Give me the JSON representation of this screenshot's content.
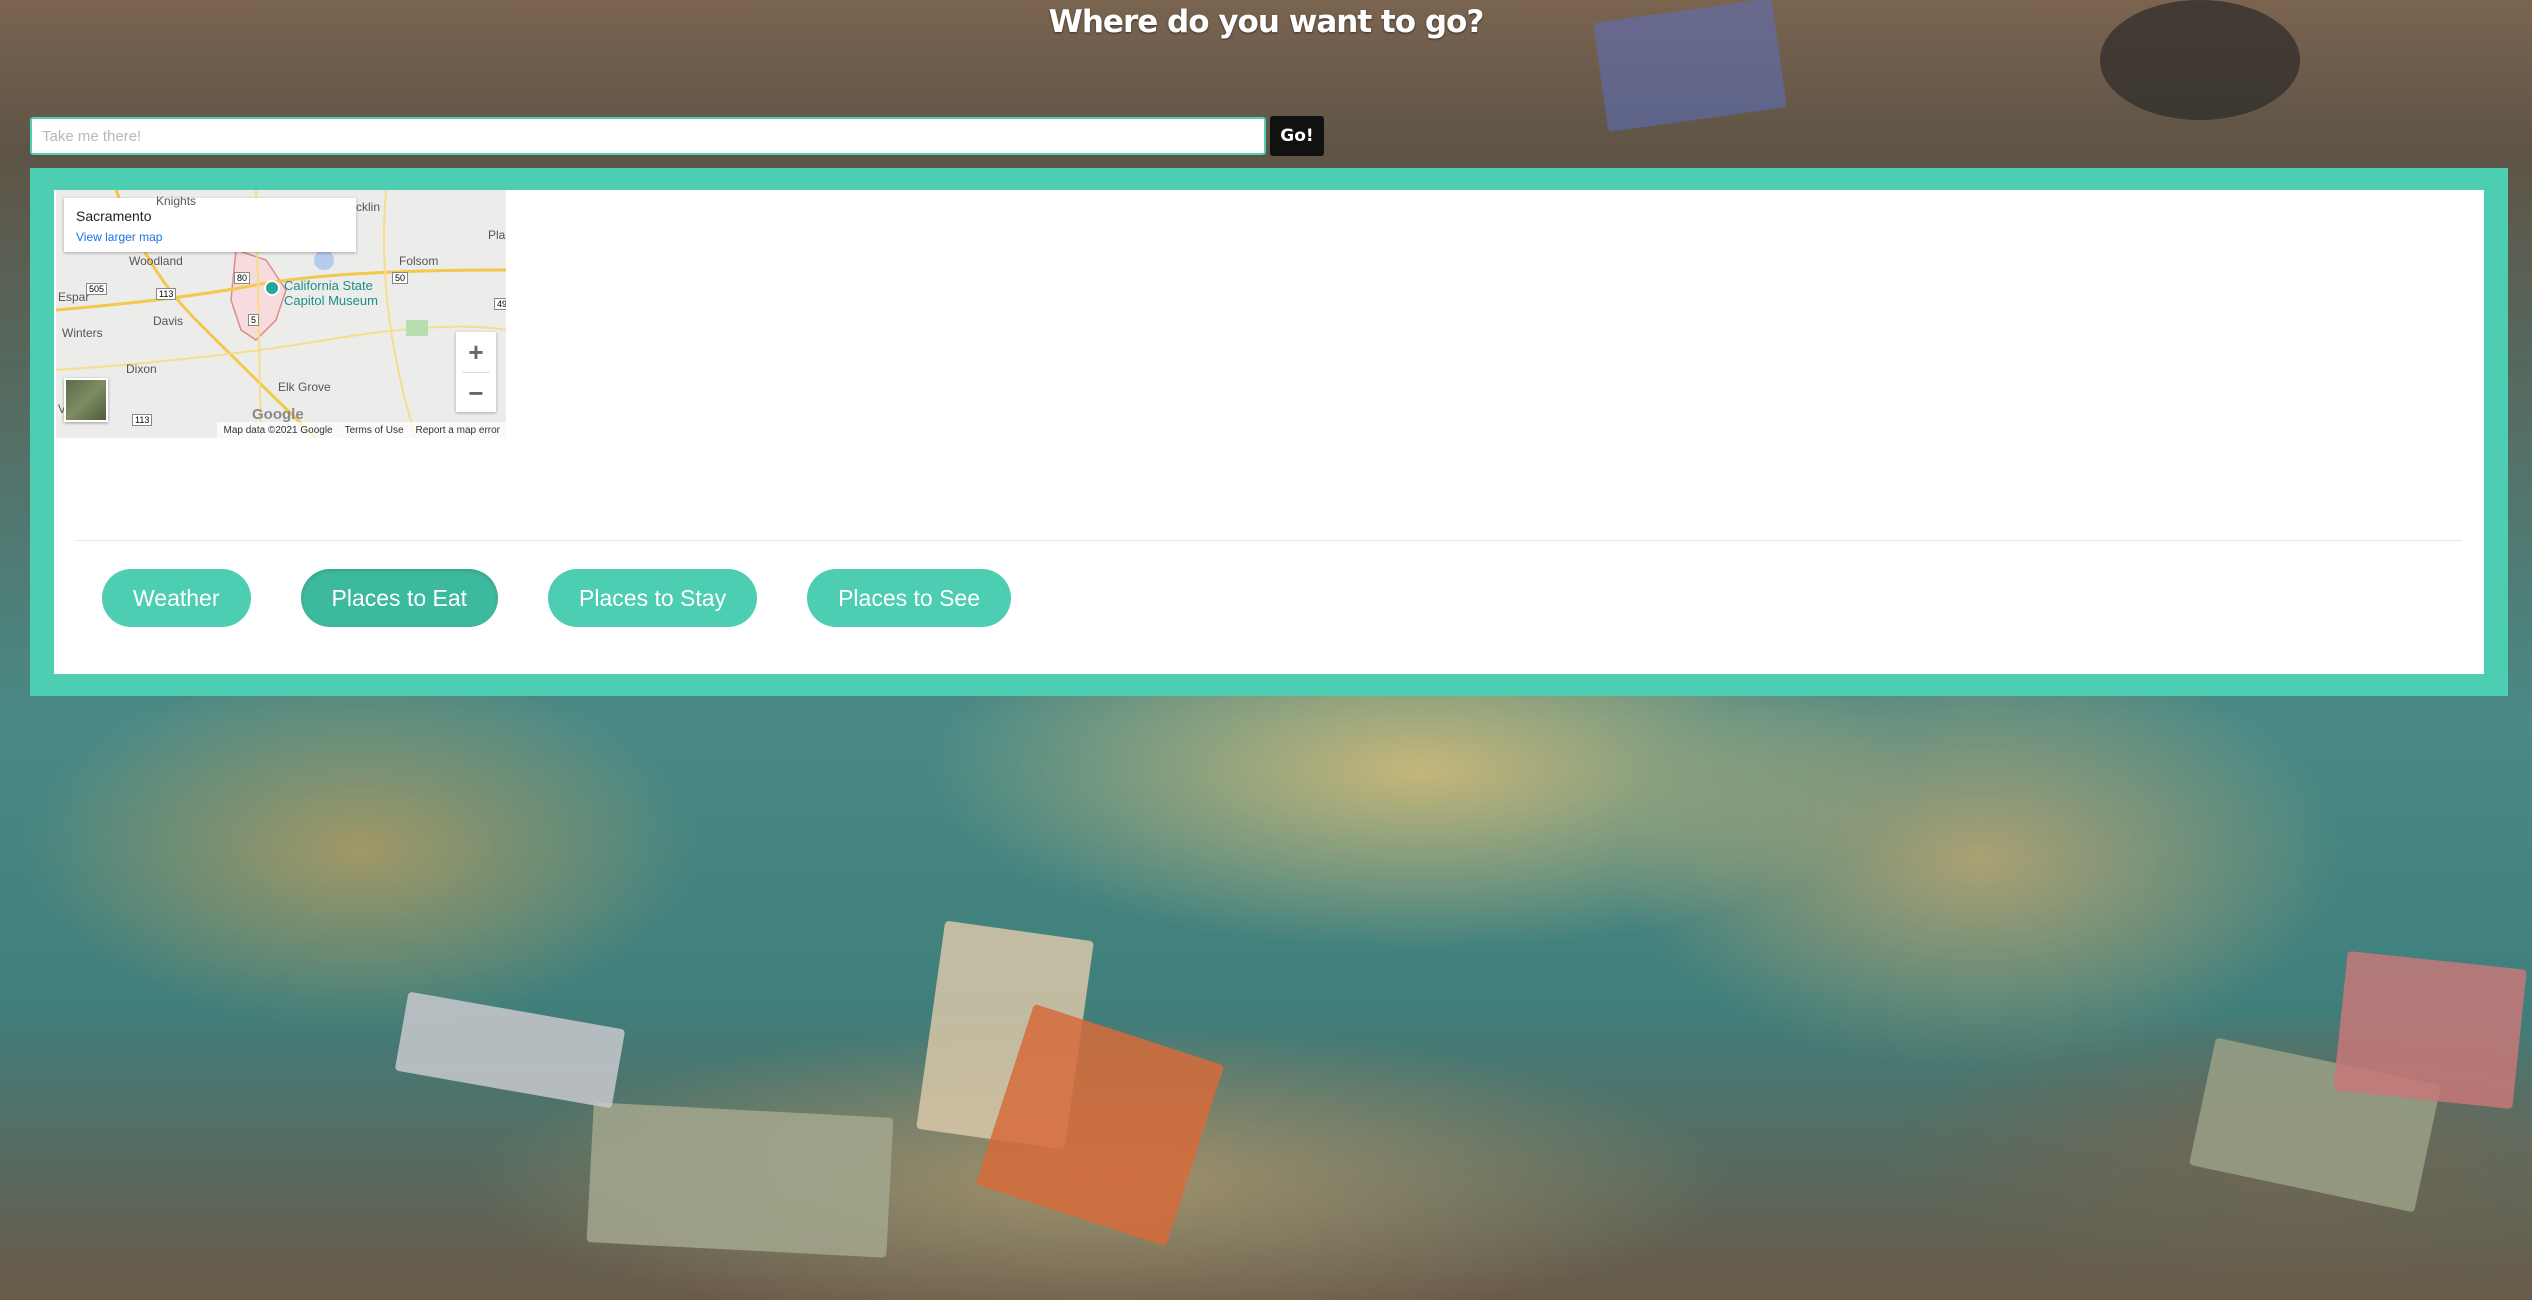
{
  "header": {
    "title": "Where do you want to go?"
  },
  "search": {
    "placeholder": "Take me there!",
    "value": "",
    "go_label": "Go!"
  },
  "map": {
    "place_name": "Sacramento",
    "view_larger_link": "View larger map",
    "labels": {
      "knights": "Knights",
      "woodland": "Woodland",
      "folsom": "Folsom",
      "davis": "Davis",
      "winters": "Winters",
      "dixon": "Dixon",
      "elk_grove": "Elk Grove",
      "rocklin": "cklin",
      "placerville": "Pla",
      "poi": "California State\nCapitol Museum",
      "espar": "Espar",
      "v": "V"
    },
    "route_shields": [
      "505",
      "113",
      "50",
      "80",
      "49",
      "113",
      "5"
    ],
    "zoom_in": "+",
    "zoom_out": "−",
    "google": "Google",
    "footer": {
      "data": "Map data ©2021 Google",
      "terms": "Terms of Use",
      "report": "Report a map error"
    }
  },
  "tabs": [
    {
      "label": "Weather",
      "active": false
    },
    {
      "label": "Places to Eat",
      "active": true
    },
    {
      "label": "Places to Stay",
      "active": false
    },
    {
      "label": "Places to See",
      "active": false
    }
  ],
  "colors": {
    "accent": "#4dcdb1",
    "accent_active": "#3db99e",
    "go_button": "#111111"
  }
}
